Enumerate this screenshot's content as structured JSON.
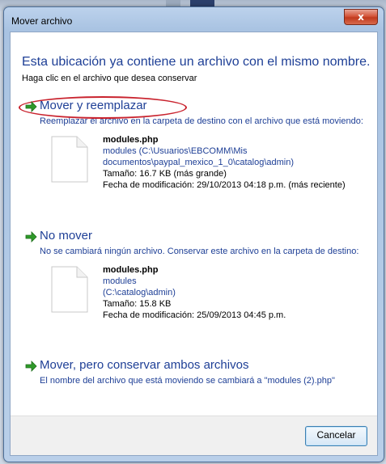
{
  "dialog": {
    "title": "Mover archivo",
    "close_glyph": "x",
    "heading": "Esta ubicación ya contiene un archivo con el mismo nombre.",
    "subheading": "Haga clic en el archivo que desea conservar"
  },
  "options": [
    {
      "title": "Mover y reemplazar",
      "description": "Reemplazar el archivo en la carpeta de destino con el archivo que está moviendo:",
      "file": {
        "name": "modules.php",
        "path_lines": [
          "modules (C:\\Usuarios\\EBCOMM\\Mis",
          "documentos\\paypal_mexico_1_0\\catalog\\admin)"
        ],
        "size": "Tamaño: 16.7 KB (más grande)",
        "modified": "Fecha de modificación: 29/10/2013 04:18 p.m. (más reciente)"
      }
    },
    {
      "title": "No mover",
      "description": "No se cambiará ningún archivo. Conservar este archivo en la carpeta de destino:",
      "file": {
        "name": "modules.php",
        "path_lines": [
          "modules",
          "(C:\\catalog\\admin)"
        ],
        "size": "Tamaño: 15.8 KB",
        "modified": "Fecha de modificación: 25/09/2013 04:45 p.m."
      }
    },
    {
      "title": "Mover, pero conservar ambos archivos",
      "description": "El nombre del archivo que está moviendo se cambiará a \"modules (2).php\""
    }
  ],
  "footer": {
    "cancel_label": "Cancelar"
  },
  "icons": {
    "option_arrow": "green-arrow-icon",
    "file": "file-icon"
  },
  "colors": {
    "link_blue": "#1e3f96",
    "arrow_green": "#2f9a2a",
    "highlight_red": "#c9232e"
  }
}
